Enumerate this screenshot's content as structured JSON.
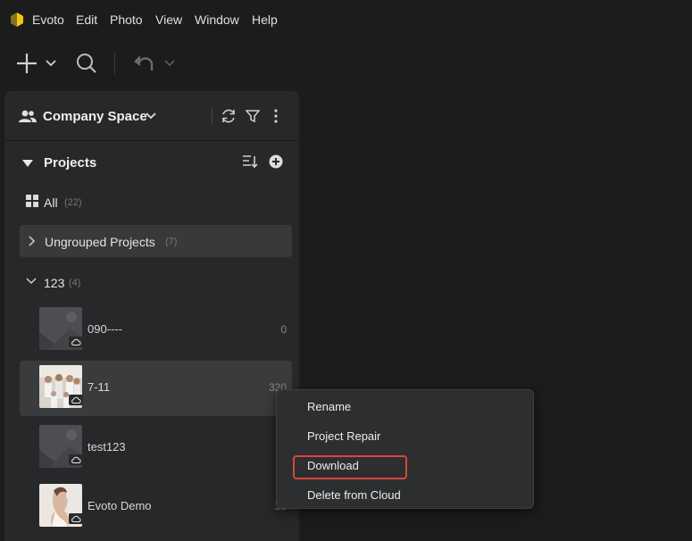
{
  "menubar": {
    "app_name": "Evoto",
    "items": [
      "Edit",
      "Photo",
      "View",
      "Window",
      "Help"
    ]
  },
  "toolbar": {
    "add_icon": "plus-icon",
    "search_icon": "search-icon",
    "undo_icon": "undo-icon"
  },
  "sidebar": {
    "space_title": "Company Space",
    "projects_title": "Projects",
    "all_label": "All",
    "all_count": "(22)",
    "ungrouped_label": "Ungrouped Projects",
    "ungrouped_count": "(7)",
    "group_label": "123",
    "group_count": "(4)",
    "projects": [
      {
        "name": "090----",
        "count": "0"
      },
      {
        "name": "7-11",
        "count": "320"
      },
      {
        "name": "test123",
        "count": ""
      },
      {
        "name": "Evoto Demo",
        "count": "35"
      }
    ]
  },
  "context_menu": {
    "items": [
      "Rename",
      "Project Repair",
      "Download",
      "Delete from Cloud"
    ],
    "highlighted": "Download"
  },
  "colors": {
    "background": "#1c1c1c",
    "panel": "#27282a",
    "highlight": "#d9443a",
    "logo": "#f5c518"
  }
}
